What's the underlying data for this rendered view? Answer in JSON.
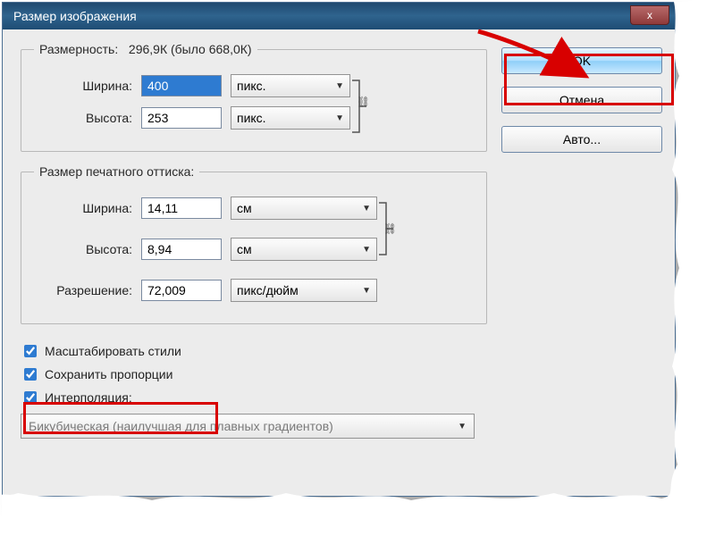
{
  "title": "Размер изображения",
  "close_x": "x",
  "buttons": {
    "ok": "OK",
    "cancel": "Отмена",
    "auto": "Авто..."
  },
  "dim": {
    "legend": "Размерность:",
    "legend_value": "296,9К (было 668,0К)",
    "width_label": "Ширина:",
    "height_label": "Высота:",
    "width_value": "400",
    "height_value": "253",
    "unit": "пикс."
  },
  "print": {
    "legend": "Размер печатного оттиска:",
    "width_label": "Ширина:",
    "height_label": "Высота:",
    "res_label": "Разрешение:",
    "width_value": "14,11",
    "height_value": "8,94",
    "res_value": "72,009",
    "unit": "см",
    "res_unit": "пикс/дюйм"
  },
  "checks": {
    "scale": "Масштабировать стили",
    "constrain": "Сохранить пропорции",
    "interp": "Интерполяция:"
  },
  "interp_value": "Бикубическая (наилучшая для плавных градиентов)"
}
